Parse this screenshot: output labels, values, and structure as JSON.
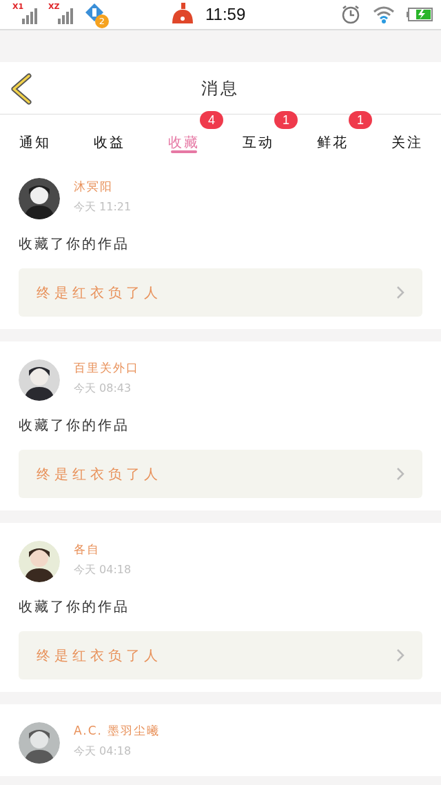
{
  "status_bar": {
    "sim1_label": "X1",
    "sim2_label": "XZ",
    "notification_count": "2",
    "time": "11:59"
  },
  "header": {
    "title": "消息"
  },
  "tabs": [
    {
      "label": "通知",
      "selected": false
    },
    {
      "label": "收益",
      "selected": false
    },
    {
      "label": "收藏",
      "selected": true,
      "badge": "4"
    },
    {
      "label": "互动",
      "selected": false,
      "badge": "1"
    },
    {
      "label": "鲜花",
      "selected": false,
      "badge": "1"
    },
    {
      "label": "关注",
      "selected": false
    }
  ],
  "messages": [
    {
      "user": "沐冥阳",
      "time": "今天 11:21",
      "action": "收藏了你的作品",
      "work": "终是红衣负了人"
    },
    {
      "user": "百里关外口",
      "time": "今天 08:43",
      "action": "收藏了你的作品",
      "work": "终是红衣负了人"
    },
    {
      "user": "各自",
      "time": "今天 04:18",
      "action": "收藏了你的作品",
      "work": "终是红衣负了人"
    },
    {
      "user": "A.C. 墨羽尘曦",
      "time": "今天 04:18"
    }
  ]
}
